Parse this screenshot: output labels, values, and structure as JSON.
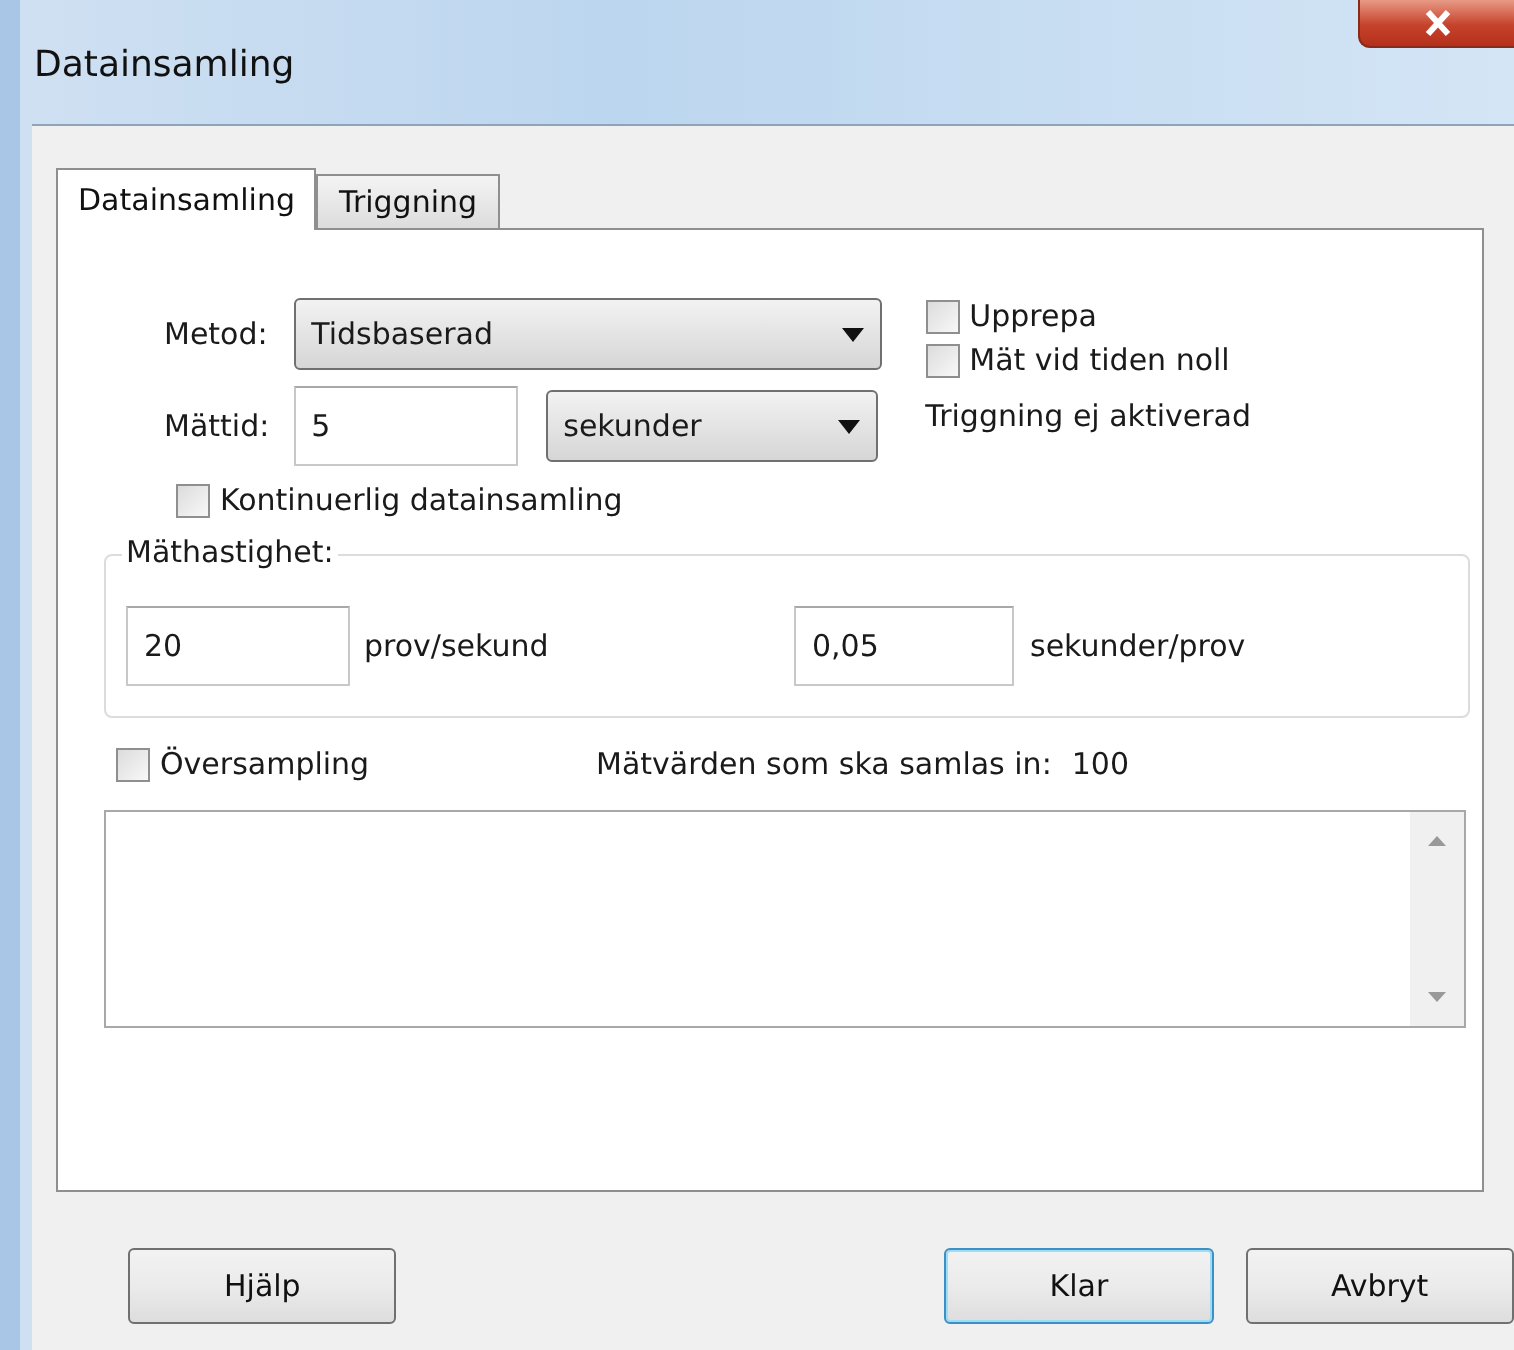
{
  "window": {
    "title": "Datainsamling"
  },
  "tabs": [
    {
      "label": "Datainsamling",
      "selected": true
    },
    {
      "label": "Triggning",
      "selected": false
    }
  ],
  "method": {
    "label": "Metod:",
    "value": "Tidsbaserad"
  },
  "duration": {
    "label": "Mättid:",
    "value": "5",
    "unit": "sekunder"
  },
  "options": [
    {
      "label": "Upprepa",
      "checked": false
    },
    {
      "label": "Mät vid tiden noll",
      "checked": false
    }
  ],
  "trigger_status": "Triggning ej aktiverad",
  "continuous": {
    "label": "Kontinuerlig datainsamling",
    "checked": false
  },
  "rate": {
    "legend": "Mäthastighet:",
    "per_second": "20",
    "per_second_unit": "prov/sekund",
    "per_sample": "0,05",
    "per_sample_unit": "sekunder/prov"
  },
  "oversampling": {
    "label": "Översampling",
    "checked": false
  },
  "sample_count": {
    "label": "Mätvärden som ska samlas in:",
    "value": "100"
  },
  "buttons": [
    {
      "label": "Hjälp",
      "focused": false
    },
    {
      "label": "Klar",
      "focused": true
    },
    {
      "label": "Avbryt",
      "focused": false
    }
  ]
}
